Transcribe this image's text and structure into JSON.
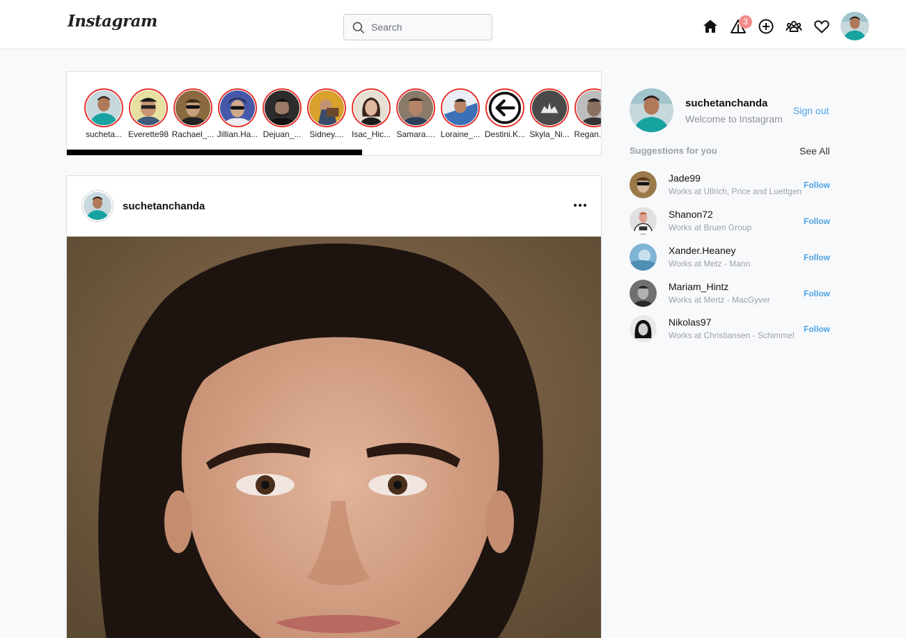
{
  "header": {
    "logo": "Instagram",
    "search_placeholder": "Search",
    "notification_count": "3",
    "icons": [
      "home-icon",
      "notification-icon",
      "add-post-icon",
      "people-icon",
      "heart-icon"
    ]
  },
  "stories": [
    {
      "name": "sucheta..."
    },
    {
      "name": "Everette98"
    },
    {
      "name": "Rachael_..."
    },
    {
      "name": "Jillian.Ha..."
    },
    {
      "name": "Dejuan_..."
    },
    {
      "name": "Sidney...."
    },
    {
      "name": "Isac_Hic..."
    },
    {
      "name": "Samara...."
    },
    {
      "name": "Loraine_..."
    },
    {
      "name": "Destini.K..."
    },
    {
      "name": "Skyla_Ni..."
    },
    {
      "name": "Regan.R..."
    }
  ],
  "post": {
    "username": "suchetanchanda",
    "more_icon": "more-icon"
  },
  "sidebar": {
    "username": "suchetanchanda",
    "welcome": "Welcome to Instagram",
    "sign_out": "Sign out",
    "suggestions_title": "Suggestions for you",
    "see_all": "See All",
    "suggestions": [
      {
        "username": "Jade99",
        "works": "Works at Ullrich, Price and Luettgen",
        "action": "Follow"
      },
      {
        "username": "Shanon72",
        "works": "Works at Bruen Group",
        "action": "Follow"
      },
      {
        "username": "Xander.Heaney",
        "works": "Works at Metz - Mann",
        "action": "Follow"
      },
      {
        "username": "Mariam_Hintz",
        "works": "Works at Mertz - MacGyver",
        "action": "Follow"
      },
      {
        "username": "Nikolas97",
        "works": "Works at Christiansen - Schimmel",
        "action": "Follow"
      }
    ]
  },
  "colors": {
    "accent": "#4da3e6",
    "story_ring": "#e4312b",
    "badge": "#f28b8b"
  }
}
